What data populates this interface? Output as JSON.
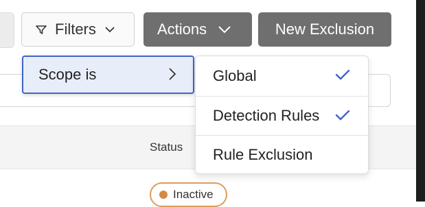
{
  "toolbar": {
    "filters_label": "Filters",
    "actions_label": "Actions",
    "new_exclusion_label": "New Exclusion"
  },
  "table": {
    "columns": {
      "status": "Status"
    },
    "rows": [
      {
        "status": "Inactive"
      }
    ]
  },
  "filter_menu": {
    "scope_label": "Scope is",
    "options": [
      {
        "label": "Global",
        "checked": true
      },
      {
        "label": "Detection Rules",
        "checked": true
      },
      {
        "label": "Rule Exclusion",
        "checked": false
      }
    ]
  },
  "colors": {
    "button_dark": "#6f6f6f",
    "accent_blue": "#3e64c9",
    "inactive_badge": "#d48a47"
  },
  "icons": {
    "filter": "funnel-icon",
    "chevron_down": "chevron-down-icon",
    "chevron_right": "chevron-right-icon",
    "check": "check-icon"
  }
}
